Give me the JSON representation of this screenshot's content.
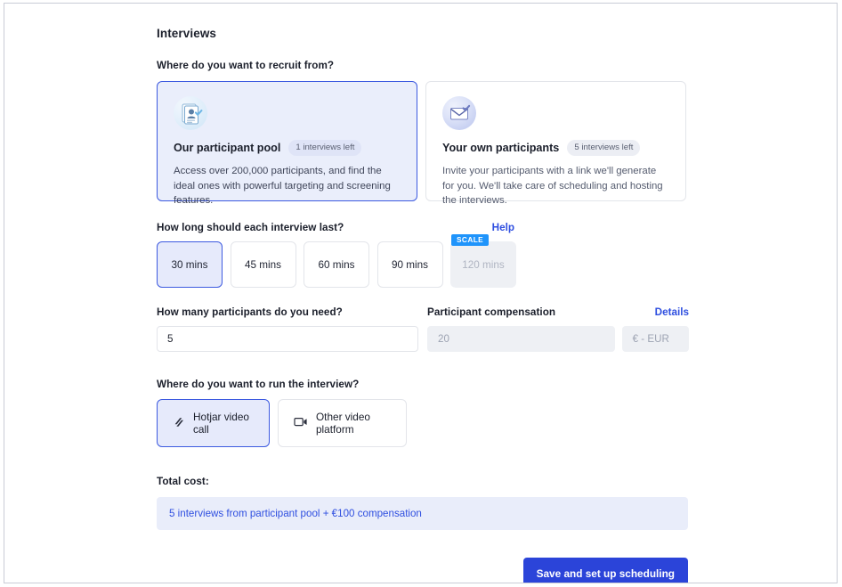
{
  "page": {
    "title": "Interviews"
  },
  "recruit": {
    "label": "Where do you want to recruit from?",
    "options": [
      {
        "icon": "participant-pool-icon",
        "title": "Our participant pool",
        "badge": "1 interviews left",
        "description": "Access over 200,000 participants, and find the ideal ones with powerful targeting and screening features.",
        "selected": true
      },
      {
        "icon": "envelope-icon",
        "title": "Your own participants",
        "badge": "5 interviews left",
        "description": "Invite your participants with a link we'll generate for you. We'll take care of scheduling and hosting the interviews.",
        "selected": false
      }
    ]
  },
  "duration": {
    "label": "How long should each interview last?",
    "help_label": "Help",
    "options": [
      {
        "label": "30 mins",
        "selected": true,
        "disabled": false,
        "badge": null
      },
      {
        "label": "45 mins",
        "selected": false,
        "disabled": false,
        "badge": null
      },
      {
        "label": "60 mins",
        "selected": false,
        "disabled": false,
        "badge": null
      },
      {
        "label": "90 mins",
        "selected": false,
        "disabled": false,
        "badge": null
      },
      {
        "label": "120 mins",
        "selected": false,
        "disabled": true,
        "badge": "SCALE"
      }
    ]
  },
  "participants": {
    "label": "How many participants do you need?",
    "value": "5",
    "placeholder": "5"
  },
  "compensation": {
    "label": "Participant compensation",
    "details_label": "Details",
    "amount_value": "20",
    "amount_placeholder": "20",
    "currency_value": "€ - EUR",
    "disabled": true
  },
  "platform": {
    "label": "Where do you want to run the interview?",
    "options": [
      {
        "icon": "hotjar-logo-icon",
        "label": "Hotjar video call",
        "selected": true
      },
      {
        "icon": "video-camera-icon",
        "label": "Other video platform",
        "selected": false
      }
    ]
  },
  "total": {
    "label": "Total cost:",
    "summary": "5 interviews from participant pool + €100 compensation"
  },
  "footer": {
    "save_label": "Save and set up scheduling"
  },
  "colors": {
    "accent": "#2b44d9",
    "link": "#2f4fe0",
    "selected_bg": "#e6eafb",
    "scale_badge": "#1f94fb",
    "banner_bg": "#e9edfa"
  }
}
